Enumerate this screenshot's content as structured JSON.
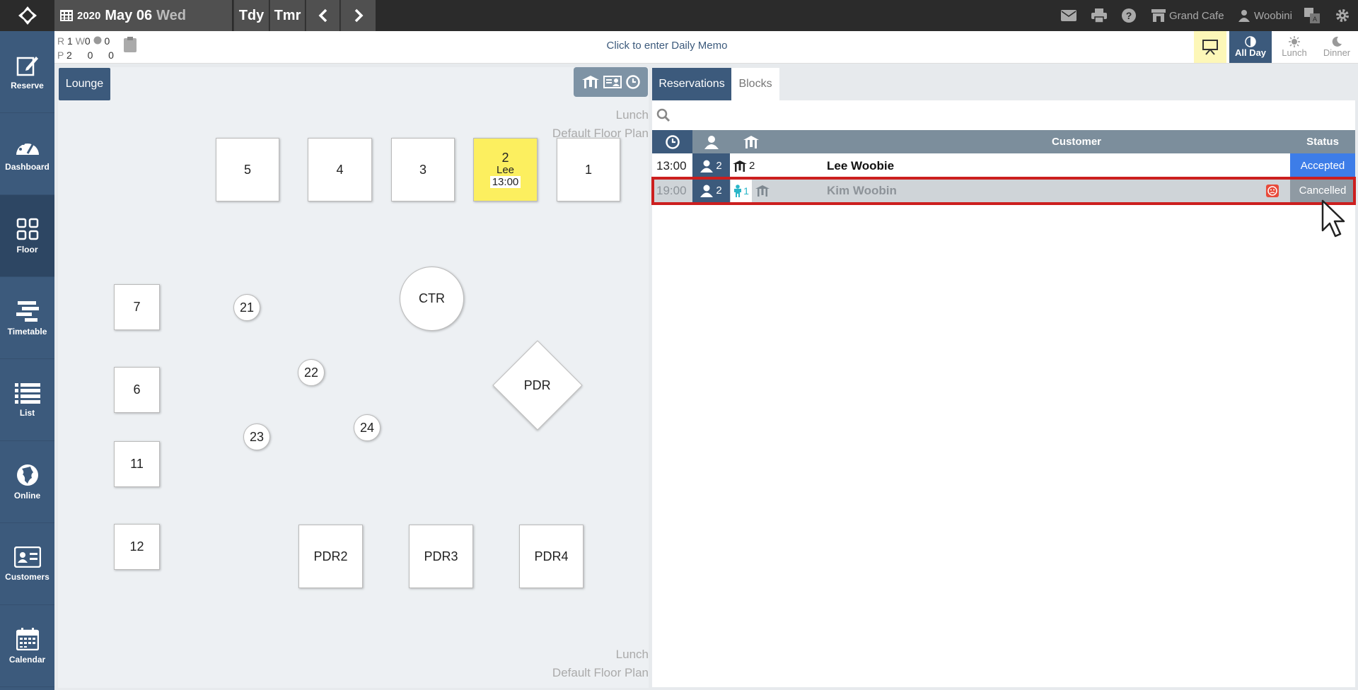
{
  "topbar": {
    "year": "2020",
    "month_day": "May 06",
    "weekday": "Wed",
    "today_label": "Tdy",
    "tomorrow_label": "Tmr",
    "restaurant_name": "Grand Cafe",
    "user_name": "Woobini"
  },
  "sidebar": {
    "items": [
      {
        "label": "Reserve",
        "icon": "edit-icon"
      },
      {
        "label": "Dashboard",
        "icon": "gauge-icon"
      },
      {
        "label": "Floor",
        "icon": "grid-icon"
      },
      {
        "label": "Timetable",
        "icon": "timetable-icon"
      },
      {
        "label": "List",
        "icon": "list-icon"
      },
      {
        "label": "Online",
        "icon": "globe-icon"
      },
      {
        "label": "Customers",
        "icon": "id-card-icon"
      },
      {
        "label": "Calendar",
        "icon": "calendar-icon"
      }
    ]
  },
  "counts": {
    "r_label": "R",
    "r_val": "1",
    "w_label": "W",
    "w_val": "0",
    "o_val": "0",
    "p_label": "P",
    "p_val": "2",
    "p_w": "0",
    "p_o": "0"
  },
  "memo": "Click to enter Daily Memo",
  "meals": {
    "all_day": "All Day",
    "lunch": "Lunch",
    "dinner": "Dinner"
  },
  "floor": {
    "area_tab": "Lounge",
    "plan_top_meal": "Lunch",
    "plan_top_name": "Default Floor Plan",
    "plan_bottom_meal": "Lunch",
    "plan_bottom_name": "Default Floor Plan",
    "tables": {
      "t5": "5",
      "t4": "4",
      "t3": "3",
      "t1": "1",
      "t2_num": "2",
      "t2_name": "Lee",
      "t2_time": "13:00",
      "t7": "7",
      "t6": "6",
      "t11": "11",
      "t12": "12",
      "t21": "21",
      "t22": "22",
      "t23": "23",
      "t24": "24",
      "ctr": "CTR",
      "pdr": "PDR",
      "pdr2": "PDR2",
      "pdr3": "PDR3",
      "pdr4": "PDR4"
    }
  },
  "reservations": {
    "tab_reservations": "Reservations",
    "tab_blocks": "Blocks",
    "search_placeholder": "",
    "header_customer": "Customer",
    "header_status": "Status",
    "rows": [
      {
        "time": "13:00",
        "pax": "2",
        "table": "2",
        "customer": "Lee Woobie",
        "status": "Accepted",
        "status_color": "#3d7de8"
      },
      {
        "time": "19:00",
        "pax": "2",
        "kids": "1",
        "customer": "Kim Woobin",
        "status": "Cancelled",
        "status_color": "#8f9aa3"
      }
    ]
  },
  "colors": {
    "sidebar": "#3c5a7c",
    "accent_yellow": "#fcef5f",
    "highlight_border": "#cc1f1f"
  }
}
